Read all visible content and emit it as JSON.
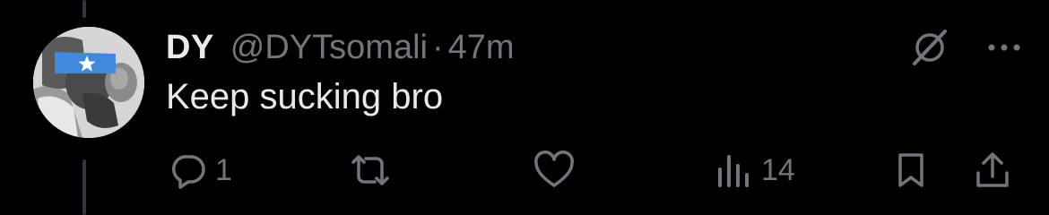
{
  "tweet": {
    "display_name": "DY",
    "handle": "@DYTsomali",
    "separator": "·",
    "time": "47m",
    "text": "Keep sucking bro"
  },
  "top_actions": {
    "icons": [
      "grok-icon",
      "more-icon"
    ]
  },
  "actions": {
    "reply": {
      "icon": "reply-icon",
      "count": "1"
    },
    "retweet": {
      "icon": "retweet-icon",
      "count": ""
    },
    "like": {
      "icon": "heart-icon",
      "count": ""
    },
    "views": {
      "icon": "views-icon",
      "count": "14"
    },
    "bookmark": {
      "icon": "bookmark-icon"
    },
    "share": {
      "icon": "share-icon"
    }
  },
  "colors": {
    "background": "#000000",
    "primary_text": "#e7e9ea",
    "secondary_text": "#71767b",
    "thread_line": "#333639",
    "flag_blue": "#4189dd"
  }
}
